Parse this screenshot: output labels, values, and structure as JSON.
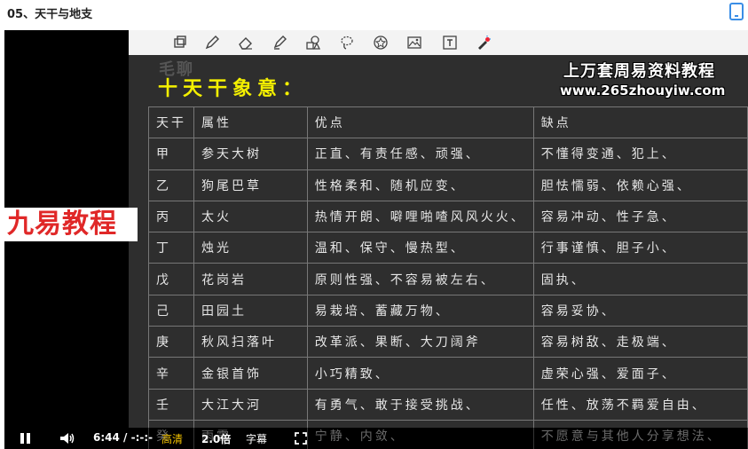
{
  "window": {
    "title": "05、天干与地支"
  },
  "toolbar": {
    "tools": [
      {
        "icon": "clear-icon"
      },
      {
        "icon": "pen-icon"
      },
      {
        "icon": "eraser-icon"
      },
      {
        "icon": "highlighter-icon"
      },
      {
        "icon": "shapes-icon"
      },
      {
        "icon": "lasso-icon"
      },
      {
        "icon": "stamp-icon"
      },
      {
        "icon": "image-icon"
      },
      {
        "icon": "text-icon"
      },
      {
        "icon": "laser-pointer-icon"
      }
    ]
  },
  "slide": {
    "logo": "毛聊",
    "title": "十天干象意：",
    "watermark_line1": "上万套周易资料教程",
    "watermark_line2": "www.265zhouyiw.com",
    "table": {
      "headers": [
        "天干",
        "属性",
        "优点",
        "缺点"
      ],
      "rows": [
        [
          "甲",
          "参天大树",
          "正直、有责任感、顽强、",
          "不懂得变通、犯上、"
        ],
        [
          "乙",
          "狗尾巴草",
          "性格柔和、随机应变、",
          "胆怯懦弱、依赖心强、"
        ],
        [
          "丙",
          "太火",
          "热情开朗、噼哩啪喳风风火火、",
          "容易冲动、性子急、"
        ],
        [
          "丁",
          "烛光",
          "温和、保守、慢热型、",
          "行事谨慎、胆子小、"
        ],
        [
          "戊",
          "花岗岩",
          "原则性强、不容易被左右、",
          "固执、"
        ],
        [
          "己",
          "田园土",
          "易栽培、蓄藏万物、",
          "容易妥协、"
        ],
        [
          "庚",
          "秋风扫落叶",
          "改革派、果断、大刀阔斧",
          "容易树敌、走极端、"
        ],
        [
          "辛",
          "金银首饰",
          "小巧精致、",
          "虚荣心强、爱面子、"
        ],
        [
          "壬",
          "大江大河",
          "有勇气、敢于接受挑战、",
          "任性、放荡不羁爱自由、"
        ],
        [
          "癸",
          "雨露",
          "宁静、内敛、",
          "不愿意与其他人分享想法、"
        ]
      ]
    }
  },
  "overlay": {
    "badge": "九易教程"
  },
  "controls": {
    "time": "6:44 / -:-:-",
    "quality": "高清",
    "speed": "2.0倍",
    "subtitle": "字幕",
    "colors": {
      "quality": "#f4c300"
    }
  }
}
